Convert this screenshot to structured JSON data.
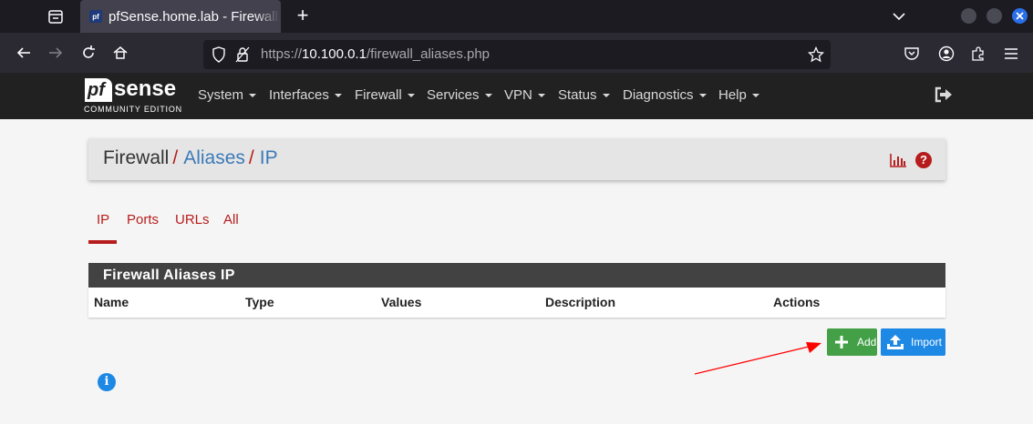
{
  "browser": {
    "tab_title": "pfSense.home.lab - Firewall: Aliases: IP",
    "favicon_text": "pf",
    "new_tab_symbol": "+",
    "url_prefix": "https://",
    "url_host": "10.100.0.1",
    "url_path": "/firewall_aliases.php",
    "accent_color": "#2a6ee8"
  },
  "header": {
    "logo_pf": "pf",
    "logo_sense": "sense",
    "logo_sub": "COMMUNITY EDITION",
    "menu": [
      "System",
      "Interfaces",
      "Firewall",
      "Services",
      "VPN",
      "Status",
      "Diagnostics",
      "Help"
    ]
  },
  "breadcrumb": {
    "root": "Firewall",
    "sep": "/",
    "level1": "Aliases",
    "level2": "IP",
    "help_symbol": "?"
  },
  "tabs": [
    "IP",
    "Ports",
    "URLs",
    "All"
  ],
  "active_tab": "IP",
  "panel": {
    "title": "Firewall Aliases IP",
    "columns": [
      "Name",
      "Type",
      "Values",
      "Description",
      "Actions"
    ],
    "rows": []
  },
  "buttons": {
    "add": "Add",
    "import": "Import",
    "add_color": "#43a047",
    "import_color": "#1e88e5"
  },
  "info_symbol": "i",
  "annotation_color": "#ff0000"
}
